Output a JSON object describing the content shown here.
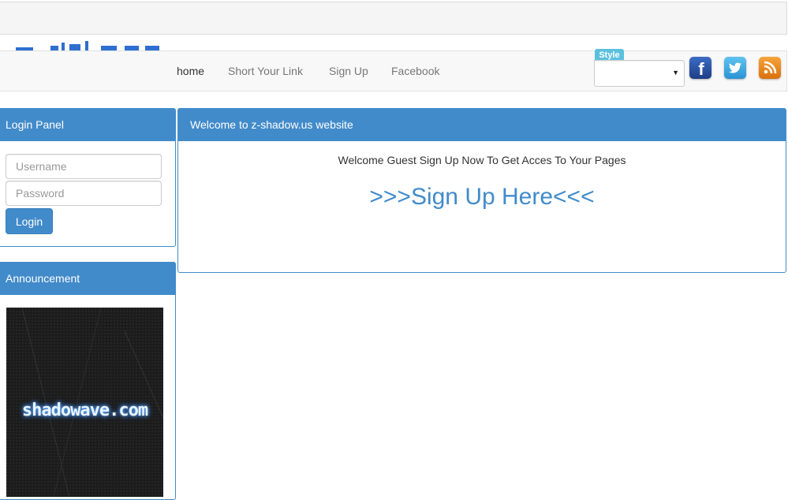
{
  "colors": {
    "primary": "#428bca",
    "info": "#5bc0de"
  },
  "nav": {
    "items": [
      {
        "label": "home",
        "active": true
      },
      {
        "label": "Short Your Link"
      },
      {
        "label": "Sign Up"
      },
      {
        "label": "Facebook"
      }
    ]
  },
  "style_switcher": {
    "badge": "Style",
    "selected": ""
  },
  "social": {
    "icons": [
      "facebook-icon",
      "twitter-icon",
      "rss-icon"
    ]
  },
  "login_panel": {
    "title": "Login Panel",
    "username_placeholder": "Username",
    "password_placeholder": "Password",
    "login_label": "Login"
  },
  "announcement": {
    "title": "Announcement",
    "banner_text": "shadowave.com"
  },
  "main_panel": {
    "title": "Welcome to z-shadow.us website",
    "welcome_text": "Welcome Guest Sign Up Now To Get Acces To Your Pages",
    "signup_link": ">>>Sign Up Here<<<"
  }
}
